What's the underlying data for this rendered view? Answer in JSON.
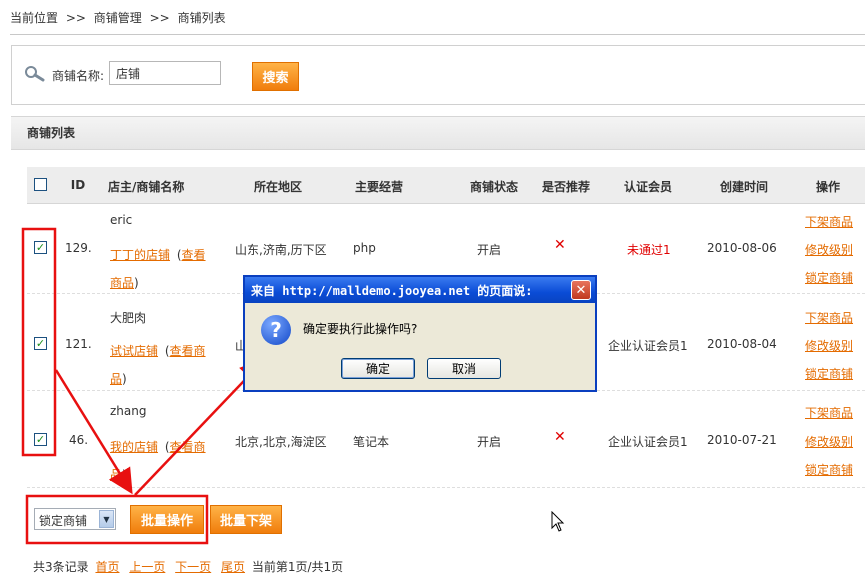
{
  "breadcrumb": {
    "current": "当前位置",
    "sep1": ">>",
    "level1": "商铺管理",
    "sep2": ">>",
    "level2": "商铺列表"
  },
  "search": {
    "label": "商铺名称:",
    "value": "店铺",
    "button": "搜索"
  },
  "section": {
    "title": "商铺列表"
  },
  "columns": [
    "ID",
    "店主/商铺名称",
    "所在地区",
    "主要经营",
    "商铺状态",
    "是否推荐",
    "认证会员",
    "创建时间",
    "操作"
  ],
  "rows": [
    {
      "id": "129.",
      "owner": "eric",
      "shop": "丁丁的店铺",
      "view_pre": "(",
      "view": "查看",
      "view2": "商品",
      "view_post": ")",
      "region": "山东,济南,历下区",
      "business": "php",
      "status": "开启",
      "recommend": "✕",
      "member": "未通过1",
      "created": "2010-08-06"
    },
    {
      "id": "121.",
      "owner": "大肥肉",
      "shop": "试试店铺",
      "view_pre": "(",
      "view": "查看商",
      "view2": "品",
      "view_post": ")",
      "region": "山",
      "business": "",
      "status": "",
      "recommend": "",
      "member": "企业认证会员1",
      "created": "2010-08-04"
    },
    {
      "id": "46.",
      "owner": "zhang",
      "shop": "我的店铺",
      "view_pre": "(",
      "view": "查看商",
      "view2": "品",
      "view_post": ")",
      "region": "北京,北京,海淀区",
      "business": "笔记本",
      "status": "开启",
      "recommend": "✕",
      "member": "企业认证会员1",
      "created": "2010-07-21"
    }
  ],
  "ops": {
    "offline": "下架商品",
    "edit_level": "修改级别",
    "lock": "锁定商铺"
  },
  "batch": {
    "select_value": "锁定商铺",
    "batch_op": "批量操作",
    "batch_off": "批量下架"
  },
  "pager": {
    "summary": "共3条记录",
    "first": "首页",
    "prev": "上一页",
    "next": "下一页",
    "last": "尾页",
    "current": "当前第1页/共1页"
  },
  "dialog": {
    "title": "来自 http://malldemo.jooyea.net 的页面说:",
    "message": "确定要执行此操作吗?",
    "ok": "确定",
    "cancel": "取消",
    "close": "✕"
  }
}
